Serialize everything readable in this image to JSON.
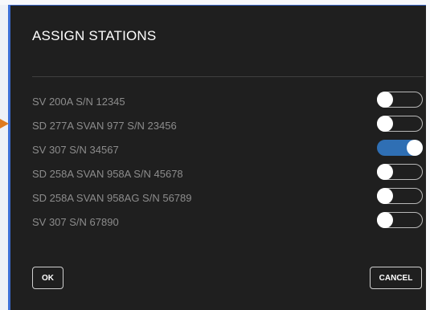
{
  "dialog": {
    "title": "ASSIGN STATIONS",
    "stations": [
      {
        "label": "SV 200A S/N 12345",
        "enabled": false
      },
      {
        "label": "SD 277A SVAN 977 S/N 23456",
        "enabled": false
      },
      {
        "label": "SV 307 S/N 34567",
        "enabled": true
      },
      {
        "label": "SD 258A SVAN 958A S/N 45678",
        "enabled": false
      },
      {
        "label": "SD 258A SVAN 958AG S/N 56789",
        "enabled": false
      },
      {
        "label": "SV 307 S/N 67890",
        "enabled": false
      }
    ],
    "ok_label": "OK",
    "cancel_label": "CANCEL"
  },
  "colors": {
    "dialog_bg": "#1f1f1f",
    "toggle_on": "#2f6fb4",
    "pointer_arrow": "#e07b1f",
    "accent_line": "#3c6fd6"
  },
  "icons": {
    "pointer": "pointer-arrow-icon"
  }
}
